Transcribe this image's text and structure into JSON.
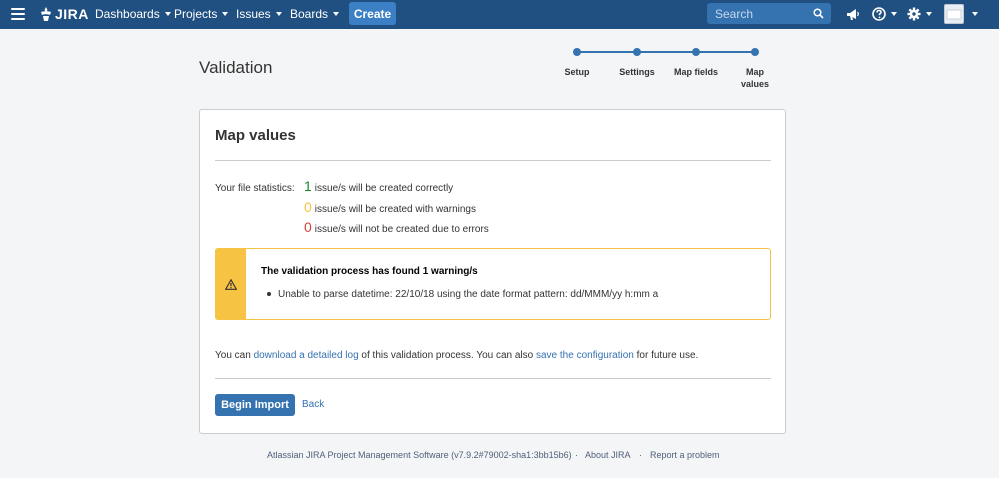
{
  "header": {
    "logo_text": "JIRA",
    "nav": [
      {
        "label": "Dashboards"
      },
      {
        "label": "Projects"
      },
      {
        "label": "Issues"
      },
      {
        "label": "Boards"
      }
    ],
    "create_label": "Create",
    "search_placeholder": "Search",
    "brand_color": "#205081"
  },
  "page": {
    "title": "Validation"
  },
  "progress": {
    "steps": [
      {
        "label": "Setup"
      },
      {
        "label": "Settings"
      },
      {
        "label": "Map fields"
      },
      {
        "label": "Map values"
      }
    ],
    "current": 4
  },
  "card": {
    "title": "Map values",
    "stats_label": "Your file statistics:",
    "stats": [
      {
        "count": "1",
        "text": "issue/s will be created correctly",
        "color": "#14892c"
      },
      {
        "count": "0",
        "text": "issue/s will be created with warnings",
        "color": "#f6c342"
      },
      {
        "count": "0",
        "text": "issue/s will not be created due to errors",
        "color": "#d04437"
      }
    ],
    "warning": {
      "title": "The validation process has found 1 warning/s",
      "items": [
        "Unable to parse datetime: 22/10/18 using the date format pattern: dd/MMM/yy h:mm a"
      ]
    },
    "log": {
      "prefix": "You can ",
      "log_link": "download a detailed log",
      "middle": " of this validation process. You can also ",
      "config_link": "save the configuration",
      "suffix": " for future use."
    },
    "begin_label": "Begin Import",
    "back_label": "Back"
  },
  "footer": {
    "version": "Atlassian JIRA Project Management Software (v7.9.2#79002-sha1:3bb15b6)",
    "sep": "·",
    "about": "About JIRA",
    "report": "Report a problem"
  }
}
